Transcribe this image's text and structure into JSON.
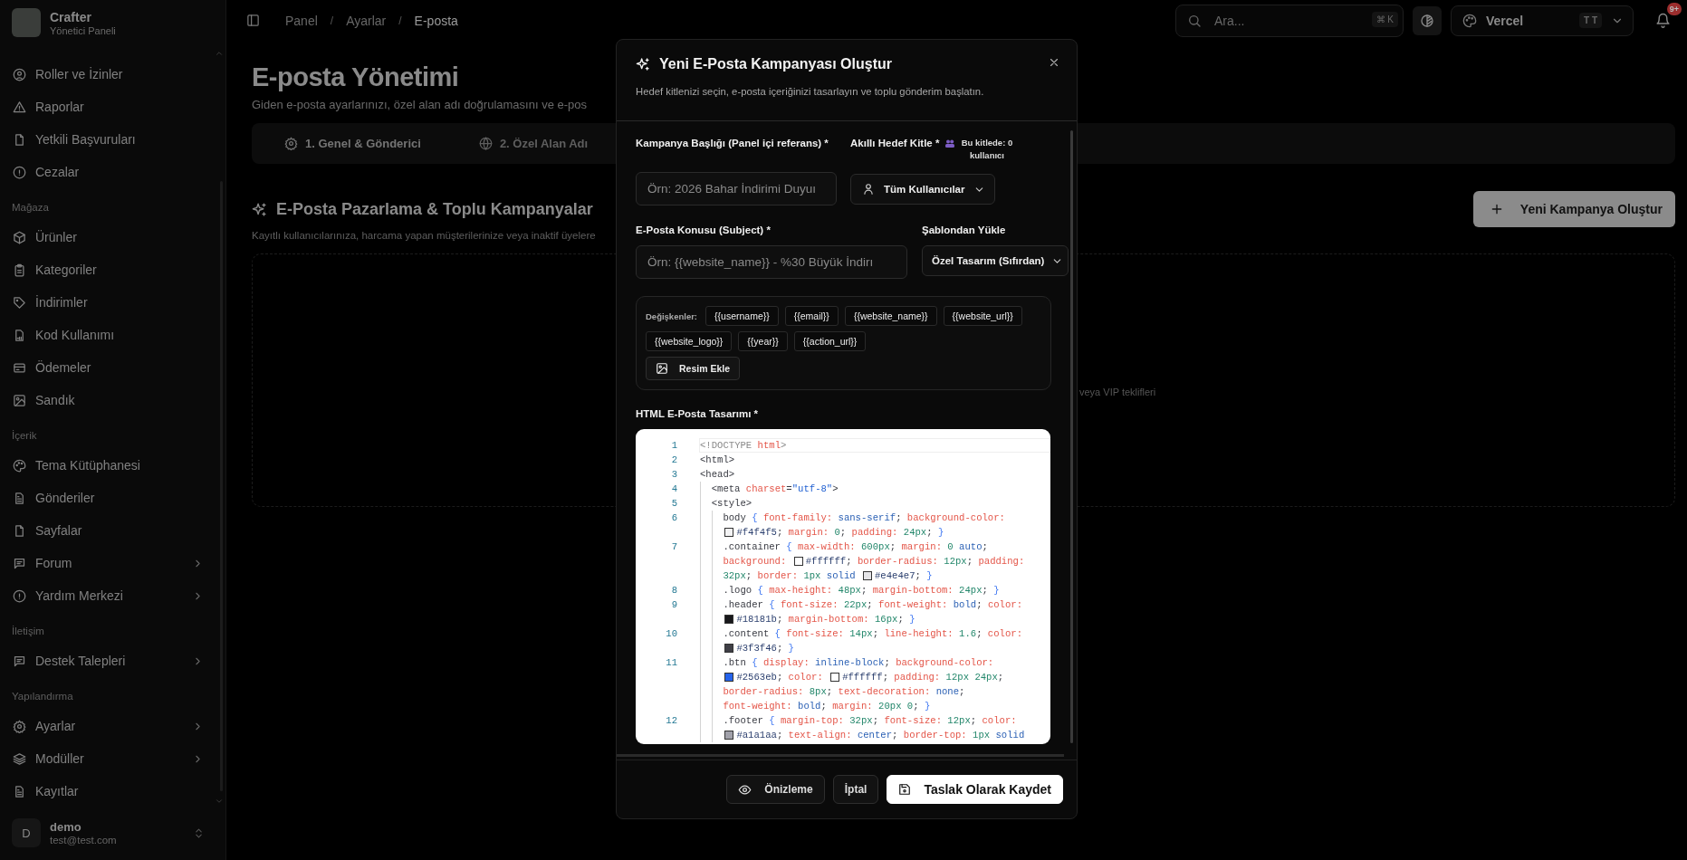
{
  "sidebar": {
    "brand": {
      "title": "Crafter",
      "subtitle": "Yönetici Paneli"
    },
    "sections": [
      {
        "items": [
          {
            "label": "Roller ve İzinler",
            "has_submenu": false
          },
          {
            "label": "Raporlar",
            "has_submenu": false
          },
          {
            "label": "Yetkili Başvuruları",
            "has_submenu": false
          },
          {
            "label": "Cezalar",
            "has_submenu": false
          }
        ]
      },
      {
        "title": "Mağaza",
        "items": [
          {
            "label": "Ürünler",
            "has_submenu": false
          },
          {
            "label": "Kategoriler",
            "has_submenu": false
          },
          {
            "label": "İndirimler",
            "has_submenu": false
          },
          {
            "label": "Kod Kullanımı",
            "has_submenu": false
          },
          {
            "label": "Ödemeler",
            "has_submenu": false
          },
          {
            "label": "Sandık",
            "has_submenu": false
          }
        ]
      },
      {
        "title": "İçerik",
        "items": [
          {
            "label": "Tema Kütüphanesi",
            "has_submenu": false
          },
          {
            "label": "Gönderiler",
            "has_submenu": false
          },
          {
            "label": "Sayfalar",
            "has_submenu": false
          },
          {
            "label": "Forum",
            "has_submenu": true
          },
          {
            "label": "Yardım Merkezi",
            "has_submenu": true
          }
        ]
      },
      {
        "title": "İletişim",
        "items": [
          {
            "label": "Destek Talepleri",
            "has_submenu": true
          }
        ]
      },
      {
        "title": "Yapılandırma",
        "items": [
          {
            "label": "Ayarlar",
            "has_submenu": true
          },
          {
            "label": "Modüller",
            "has_submenu": true
          },
          {
            "label": "Kayıtlar",
            "has_submenu": false
          }
        ]
      }
    ],
    "user": {
      "initial": "D",
      "name": "demo",
      "email": "test@test.com"
    }
  },
  "header": {
    "breadcrumb": [
      {
        "label": "Panel",
        "selected": false
      },
      {
        "label": "Ayarlar",
        "selected": false
      },
      {
        "label": "E-posta",
        "selected": true
      }
    ],
    "separator": "/",
    "search": {
      "placeholder": "Ara...",
      "shortcut": "⌘ K"
    },
    "theme": {
      "name": "Vercel",
      "badge": "T T"
    },
    "notifications": "9+"
  },
  "page": {
    "title": "E-posta Yönetimi",
    "subtitle": "Giden e-posta ayarlarınızı, özel alan adı doğrulamasını ve e-pos",
    "tabs": [
      {
        "label": "1. Genel & Gönderici",
        "selected": true
      },
      {
        "label": "2. Özel Alan Adı",
        "selected": false
      }
    ],
    "section": {
      "title": "E-Posta Pazarlama & Toplu Kampanyalar",
      "subtitle": "Kayıtlı kullanıcılarınıza, harcama yapan müşterilerinize veya inaktif üyelere",
      "new_button": "Yeni Kampanya Oluştur",
      "empty_text": "veya VIP teklifleri"
    }
  },
  "modal": {
    "title": "Yeni E-Posta Kampanyası Oluştur",
    "subtitle": "Hedef kitlenizi seçin, e-posta içeriğinizi tasarlayın ve toplu gönderim başlatın.",
    "campaign_title": {
      "label": "Kampanya Başlığı (Panel içi referans) *",
      "placeholder": "Örn: 2026 Bahar İndirimi Duyuı"
    },
    "audience": {
      "label": "Akıllı Hedef Kitle *",
      "count": "Bu kitlede: 0 kullanıcı",
      "value": "Tüm Kullanıcılar"
    },
    "subject": {
      "label": "E-Posta Konusu (Subject) *",
      "placeholder": "Örn: {{website_name}} - %30 Büyük İndirı"
    },
    "template": {
      "label": "Şablondan Yükle",
      "value": "Özel Tasarım (Sıfırdan)"
    },
    "variables": {
      "label": "Değişkenler:",
      "items": [
        "{{username}}",
        "{{email}}",
        "{{website_name}}",
        "{{website_url}}",
        "{{website_logo}}",
        "{{year}}",
        "{{action_url}}"
      ],
      "image_button": "Resim Ekle"
    },
    "editor": {
      "label": "HTML E-Posta Tasarımı *",
      "lines": [
        {
          "number": "1",
          "active": true,
          "rows": [
            "<!DOCTYPE html>"
          ]
        },
        {
          "number": "2",
          "active": false,
          "rows": [
            "<html>"
          ]
        },
        {
          "number": "3",
          "active": false,
          "rows": [
            "<head>"
          ]
        },
        {
          "number": "4",
          "active": false,
          "rows": [
            "  <meta charset=\"utf-8\">"
          ]
        },
        {
          "number": "5",
          "active": false,
          "rows": [
            "  <style>"
          ]
        },
        {
          "number": "6",
          "active": false,
          "rows": [
            "    body { font-family: sans-serif; background-color:",
            "    #f4f4f5; margin: 0; padding: 24px; }"
          ]
        },
        {
          "number": "7",
          "active": false,
          "rows": [
            "    .container { max-width: 600px; margin: 0 auto;",
            "    background: #ffffff; border-radius: 12px; padding:",
            "    32px; border: 1px solid #e4e4e7; }"
          ]
        },
        {
          "number": "8",
          "active": false,
          "rows": [
            "    .logo { max-height: 48px; margin-bottom: 24px; }"
          ]
        },
        {
          "number": "9",
          "active": false,
          "rows": [
            "    .header { font-size: 22px; font-weight: bold; color:",
            "    #18181b; margin-bottom: 16px; }"
          ]
        },
        {
          "number": "10",
          "active": false,
          "rows": [
            "    .content { font-size: 14px; line-height: 1.6; color:",
            "    #3f3f46; }"
          ]
        },
        {
          "number": "11",
          "active": false,
          "rows": [
            "    .btn { display: inline-block; background-color:",
            "    #2563eb; color: #ffffff; padding: 12px 24px;",
            "    border-radius: 8px; text-decoration: none;",
            "    font-weight: bold; margin: 20px 0; }"
          ]
        },
        {
          "number": "12",
          "active": false,
          "rows": [
            "    .footer { margin-top: 32px; font-size: 12px; color:",
            "    #a1a1aa; text-align: center; border-top: 1px solid"
          ]
        }
      ]
    },
    "buttons": {
      "preview": "Önizleme",
      "cancel": "İptal",
      "save": "Taslak Olarak Kaydet"
    }
  }
}
